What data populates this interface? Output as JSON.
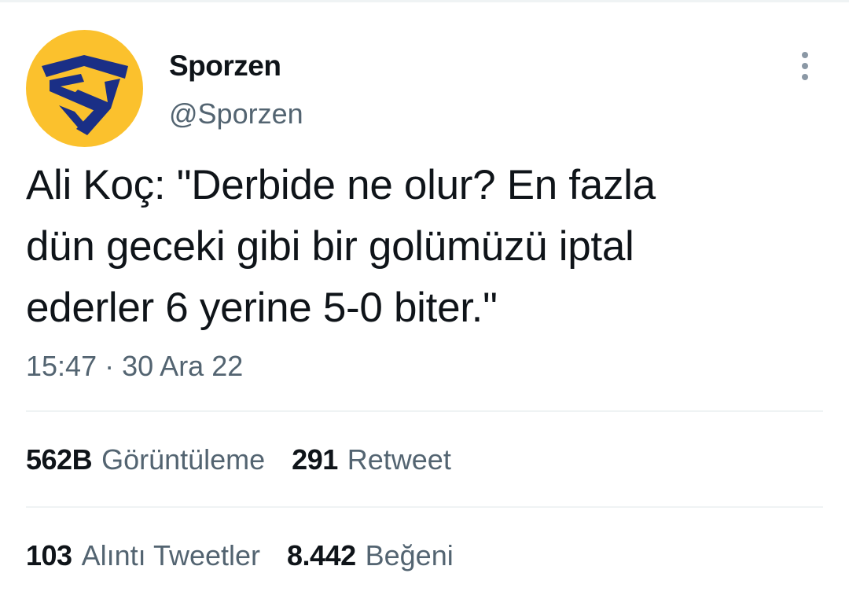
{
  "tweet": {
    "author": {
      "display_name": "Sporzen",
      "handle": "@Sporzen",
      "avatar_bg": "#fbc12d",
      "avatar_mark": "#1a2f86"
    },
    "text_lines": [
      "Ali Koç: \"Derbide ne olur? En fazla",
      "dün geceki gibi bir golümüzü iptal",
      "ederler 6 yerine 5-0 biter.\""
    ],
    "time": "15:47",
    "separator": "·",
    "date": "30 Ara 22",
    "stats": {
      "views": {
        "count": "562B",
        "label": "Görüntüleme"
      },
      "retweets": {
        "count": "291",
        "label": "Retweet"
      },
      "quotes": {
        "count": "103",
        "label": "Alıntı Tweetler"
      },
      "likes": {
        "count": "8.442",
        "label": "Beğeni"
      }
    },
    "more_icon": "more-vertical-icon"
  }
}
